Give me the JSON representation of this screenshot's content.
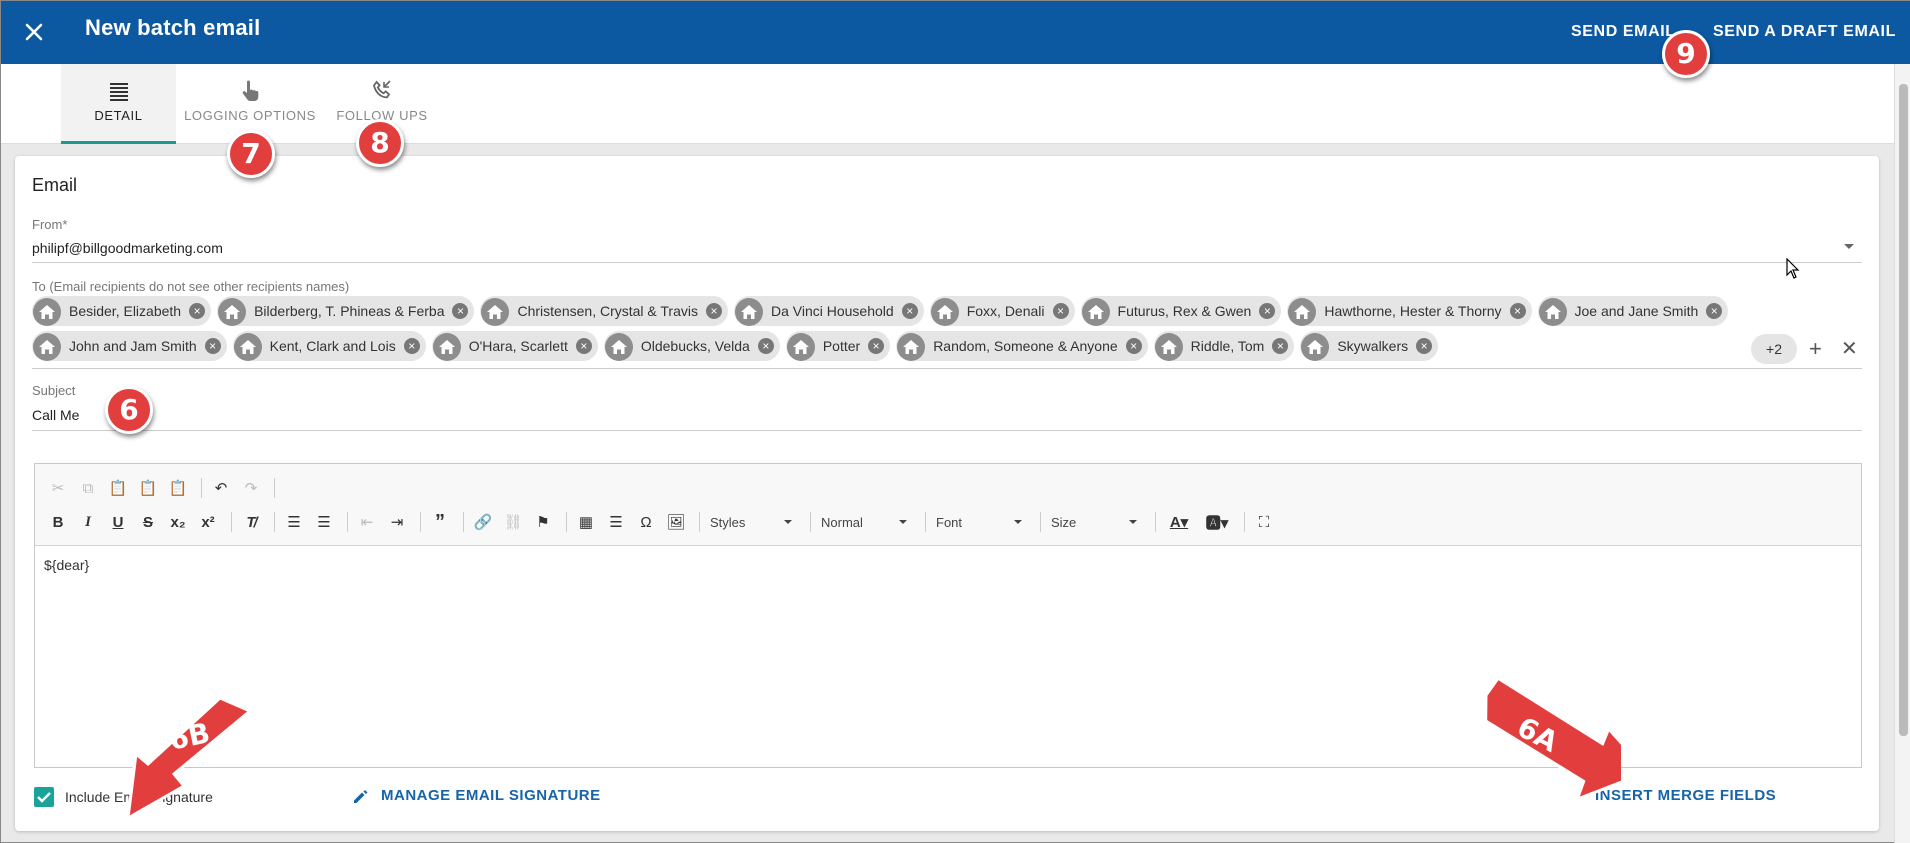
{
  "header": {
    "title": "New batch email",
    "close_icon": "close-icon",
    "send_email": "SEND EMAIL",
    "send_draft": "SEND A DRAFT EMAIL",
    "background": "#0c58a1"
  },
  "tabs": [
    {
      "label": "DETAIL",
      "icon": "list-icon",
      "active": true
    },
    {
      "label": "LOGGING OPTIONS",
      "icon": "pointer-hand-icon",
      "active": false
    },
    {
      "label": "FOLLOW UPS",
      "icon": "phone-callback-icon",
      "active": false
    }
  ],
  "email": {
    "section_title": "Email",
    "from_label": "From*",
    "from_value": "philipf@billgoodmarketing.com",
    "to_label": "To (Email recipients do not see other recipients names)",
    "recipients": [
      "Besider, Elizabeth",
      "Bilderberg, T. Phineas & Ferba",
      "Christensen, Crystal & Travis",
      "Da Vinci Household",
      "Foxx, Denali",
      "Futurus, Rex & Gwen",
      "Hawthorne, Hester & Thorny",
      "Joe and Jane Smith",
      "John and Jam Smith",
      "Kent, Clark and Lois",
      "O'Hara, Scarlett",
      "Oldebucks, Velda",
      "Potter",
      "Random, Someone & Anyone",
      "Riddle, Tom",
      "Skywalkers"
    ],
    "more_recipients": "+2",
    "subject_label": "Subject",
    "subject_value": "Call Me"
  },
  "editor": {
    "combos": [
      "Styles",
      "Normal",
      "Font",
      "Size"
    ],
    "body": "${dear}"
  },
  "footer": {
    "include_signature_label": "Include Email Signature",
    "include_signature_checked": true,
    "manage_signature": "MANAGE EMAIL SIGNATURE",
    "insert_merge_fields": "INSERT MERGE FIELDS",
    "accent_color": "#1aa39a",
    "link_color": "#1764a8"
  },
  "annotations": {
    "badges": [
      "6",
      "7",
      "8",
      "9"
    ],
    "arrows": [
      "6B",
      "6A"
    ],
    "color": "#e33e3e"
  }
}
